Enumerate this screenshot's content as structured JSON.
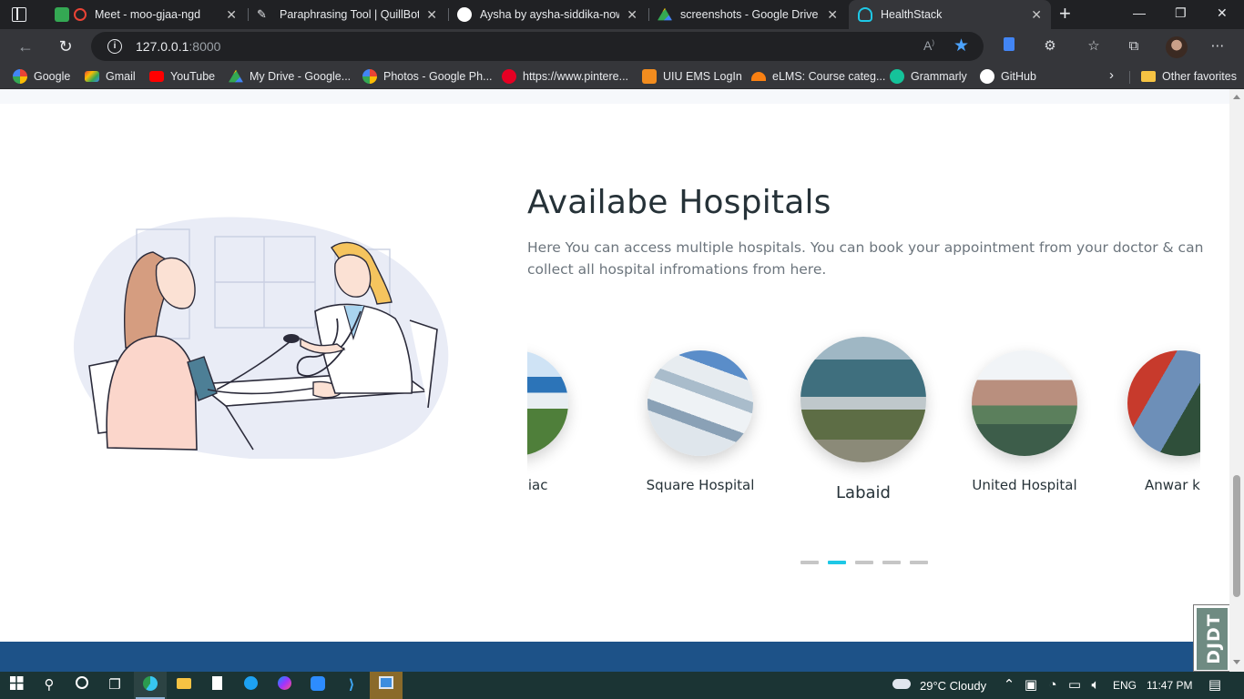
{
  "browser": {
    "tabs": [
      {
        "title": "Meet - moo-gjaa-ngd",
        "icon": "google-meet-icon",
        "color": "#34a853"
      },
      {
        "title": "Paraphrasing Tool | QuillBot AI",
        "icon": "quillbot-icon",
        "color": "#e8eaed"
      },
      {
        "title": "Aysha by aysha-siddika-nowshin",
        "icon": "github-icon",
        "color": "#ffffff"
      },
      {
        "title": "screenshots - Google Drive",
        "icon": "google-drive-icon",
        "color": "#fbbc04"
      },
      {
        "title": "HealthStack",
        "icon": "healthstack-icon",
        "color": "#1ec8e6",
        "active": true
      }
    ],
    "new_tab": "+",
    "window_controls": {
      "minimize": "—",
      "restore": "❐",
      "close": "✕"
    },
    "address": {
      "host": "127.0.0.1",
      "port": ":8000"
    },
    "bookmarks": [
      {
        "label": "Google",
        "icon": "google-icon",
        "color": "#4285f4"
      },
      {
        "label": "Gmail",
        "icon": "gmail-icon",
        "color": "#ea4335"
      },
      {
        "label": "YouTube",
        "icon": "youtube-icon",
        "color": "#ff0000"
      },
      {
        "label": "My Drive - Google...",
        "icon": "google-drive-icon",
        "color": "#fbbc04"
      },
      {
        "label": "Photos - Google Ph...",
        "icon": "google-photos-icon",
        "color": "#34a853"
      },
      {
        "label": "https://www.pintere...",
        "icon": "pinterest-icon",
        "color": "#e60023"
      },
      {
        "label": "UIU EMS LogIn",
        "icon": "uiu-icon",
        "color": "#f28c1e"
      },
      {
        "label": "eLMS: Course categ...",
        "icon": "elms-icon",
        "color": "#f98012"
      },
      {
        "label": "Grammarly",
        "icon": "grammarly-icon",
        "color": "#15c39a"
      },
      {
        "label": "GitHub",
        "icon": "github-icon",
        "color": "#ffffff"
      }
    ],
    "other_favorites": "Other favorites"
  },
  "page": {
    "section_title": "Availabe Hospitals",
    "section_description": "Here You can access multiple hospitals. You can book your appointment from your doctor & can collect all hospital infromations from here.",
    "hospitals": [
      {
        "name": "Ibrahim Cardiac",
        "visible_name": "n Cardiac",
        "image": "hospital-building-photo",
        "active": false
      },
      {
        "name": "Square Hospital",
        "image": "hospital-building-photo",
        "active": false
      },
      {
        "name": "Labaid",
        "image": "hospital-building-photo",
        "active": true
      },
      {
        "name": "United Hospital",
        "image": "hospital-building-photo",
        "active": false
      },
      {
        "name": "Anwar Khan",
        "visible_name": "Anwar k",
        "image": "hospital-building-photo",
        "active": false
      }
    ],
    "carousel_dots": 5,
    "carousel_active_dot": 1,
    "accent_color": "#1ec8e6",
    "footer_color": "#1d5288",
    "debug_toolbar_label": "DJDT"
  },
  "taskbar": {
    "weather": "29°C  Cloudy",
    "language": "ENG",
    "time": "11:47 PM"
  }
}
